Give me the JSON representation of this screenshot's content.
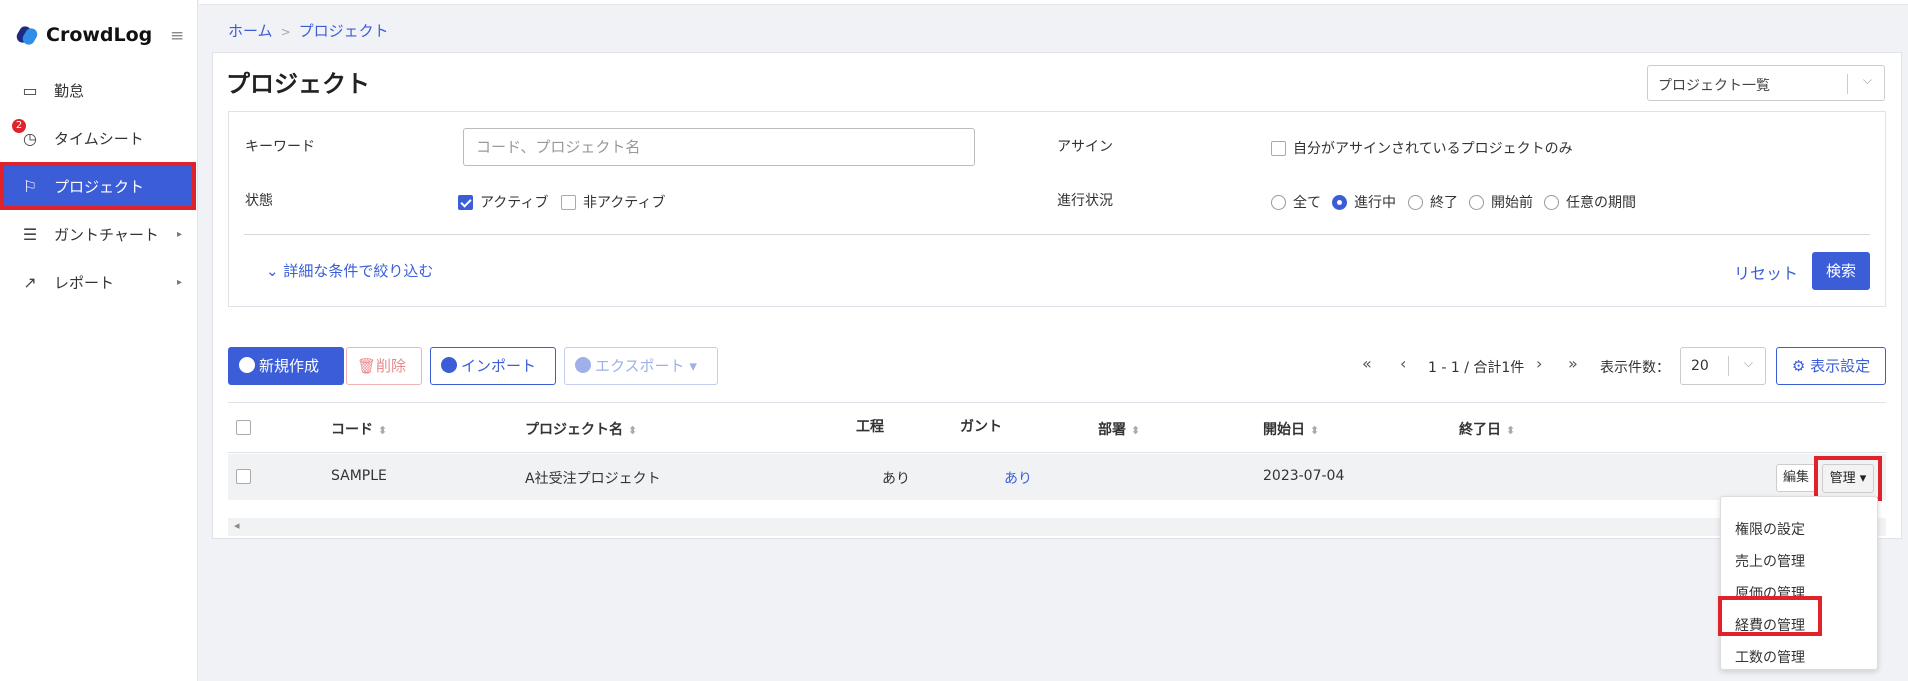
{
  "app": {
    "name": "CrowdLog"
  },
  "sidebar": {
    "items": [
      {
        "label": "勤怠",
        "icon": "calendar-icon"
      },
      {
        "label": "タイムシート",
        "icon": "clock-icon",
        "badge": "2"
      },
      {
        "label": "プロジェクト",
        "icon": "flag-icon",
        "active": true
      },
      {
        "label": "ガントチャート",
        "icon": "gantt-icon"
      },
      {
        "label": "レポート",
        "icon": "trend-icon"
      }
    ]
  },
  "breadcrumb": {
    "home": "ホーム",
    "sep": ">",
    "current": "プロジェクト"
  },
  "page": {
    "title": "プロジェクト",
    "view_select": "プロジェクト一覧"
  },
  "filters": {
    "keyword_label": "キーワード",
    "keyword_placeholder": "コード、プロジェクト名",
    "assign_label": "アサイン",
    "assign_option": "自分がアサインされているプロジェクトのみ",
    "status_label": "状態",
    "status_active": "アクティブ",
    "status_inactive": "非アクティブ",
    "progress_label": "進行状況",
    "progress_options": [
      "全て",
      "進行中",
      "終了",
      "開始前",
      "任意の期間"
    ],
    "progress_selected": "進行中",
    "more": "詳細な条件で絞り込む",
    "reset": "リセット",
    "search": "検索"
  },
  "toolbar": {
    "new": "新規作成",
    "delete": "削除",
    "import": "インポート",
    "export": "エクスポート",
    "pager_text": "1 - 1 / 合計1件",
    "page_size_label": "表示件数：",
    "page_size": "20",
    "display_settings": "表示設定"
  },
  "table": {
    "headers": [
      "コード",
      "プロジェクト名",
      "工程",
      "ガント",
      "部署",
      "開始日",
      "終了日"
    ],
    "rows": [
      {
        "code": "SAMPLE",
        "name": "A社受注プロジェクト",
        "process": "あり",
        "gantt": "あり",
        "dept": "",
        "start": "2023-07-04",
        "end": ""
      }
    ],
    "edit": "編集",
    "manage": "管理"
  },
  "manage_menu": [
    "権限の設定",
    "売上の管理",
    "原価の管理",
    "経費の管理",
    "工数の管理"
  ],
  "colors": {
    "accent": "#3b5ed8",
    "highlight": "#e0222b"
  }
}
